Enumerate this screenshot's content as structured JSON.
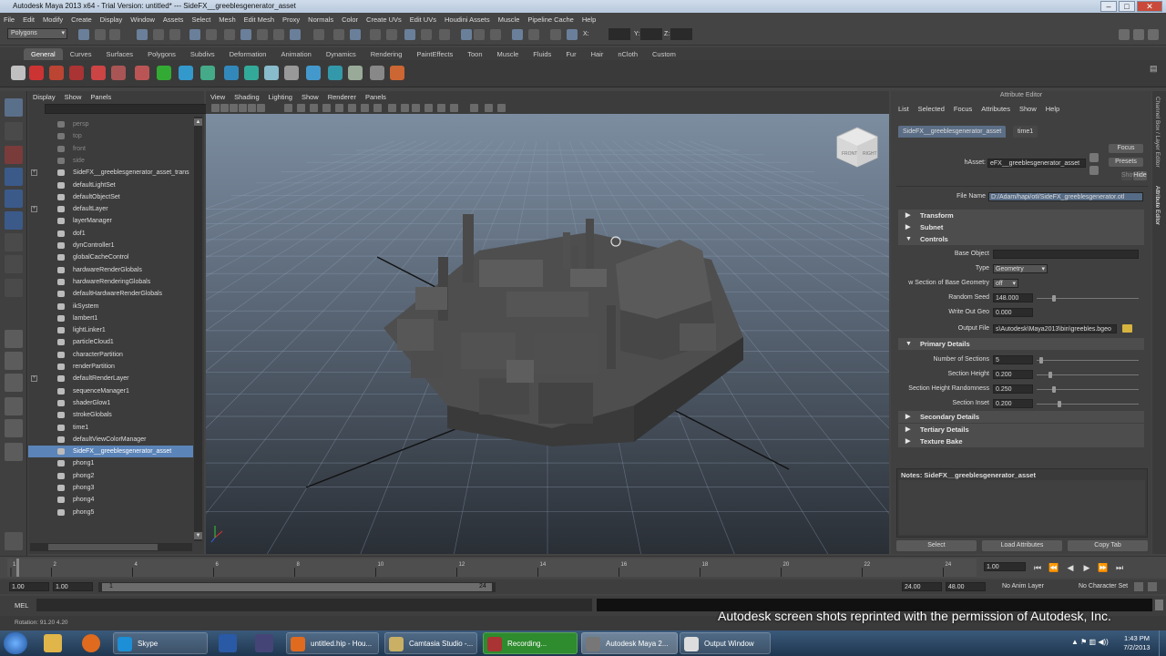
{
  "window": {
    "title": "Autodesk Maya 2013 x64 - Trial Version: untitled*   ---   SideFX__greeblesgenerator_asset"
  },
  "menubar": [
    "File",
    "Edit",
    "Modify",
    "Create",
    "Display",
    "Window",
    "Assets",
    "Select",
    "Mesh",
    "Edit Mesh",
    "Proxy",
    "Normals",
    "Color",
    "Create UVs",
    "Edit UVs",
    "Houdini Assets",
    "Muscle",
    "Pipeline Cache",
    "Help"
  ],
  "statusline": {
    "mode": "Polygons",
    "x_label": "X:",
    "y_label": "Y:",
    "z_label": "Z:"
  },
  "shelf_tabs": [
    "General",
    "Curves",
    "Surfaces",
    "Polygons",
    "Subdivs",
    "Deformation",
    "Animation",
    "Dynamics",
    "Rendering",
    "PaintEffects",
    "Toon",
    "Muscle",
    "Fluids",
    "Fur",
    "Hair",
    "nCloth",
    "Custom"
  ],
  "shelf_active": "General",
  "outliner": {
    "menu": [
      "Display",
      "Show",
      "Panels"
    ],
    "items": [
      {
        "label": "persp",
        "dim": true
      },
      {
        "label": "top",
        "dim": true
      },
      {
        "label": "front",
        "dim": true
      },
      {
        "label": "side",
        "dim": true
      },
      {
        "label": "SideFX__greeblesgenerator_asset_trans",
        "expand": true
      },
      {
        "label": "defaultLightSet"
      },
      {
        "label": "defaultObjectSet"
      },
      {
        "label": "defaultLayer",
        "expand": true
      },
      {
        "label": "layerManager"
      },
      {
        "label": "dof1"
      },
      {
        "label": "dynController1"
      },
      {
        "label": "globalCacheControl"
      },
      {
        "label": "hardwareRenderGlobals"
      },
      {
        "label": "hardwareRenderingGlobals"
      },
      {
        "label": "defaultHardwareRenderGlobals"
      },
      {
        "label": "ikSystem"
      },
      {
        "label": "lambert1"
      },
      {
        "label": "lightLinker1"
      },
      {
        "label": "particleCloud1"
      },
      {
        "label": "characterPartition"
      },
      {
        "label": "renderPartition"
      },
      {
        "label": "defaultRenderLayer",
        "expand": true
      },
      {
        "label": "sequenceManager1"
      },
      {
        "label": "shaderGlow1"
      },
      {
        "label": "strokeGlobals"
      },
      {
        "label": "time1"
      },
      {
        "label": "defaultViewColorManager"
      },
      {
        "label": "SideFX__greeblesgenerator_asset",
        "selected": true
      },
      {
        "label": "phong1"
      },
      {
        "label": "phong2"
      },
      {
        "label": "phong3"
      },
      {
        "label": "phong4"
      },
      {
        "label": "phong5"
      }
    ]
  },
  "viewport": {
    "menu": [
      "View",
      "Shading",
      "Lighting",
      "Show",
      "Renderer",
      "Panels"
    ],
    "viewcube_left": "FRONT",
    "viewcube_right": "RIGHT"
  },
  "attribute_editor": {
    "title": "Attribute Editor",
    "menu": [
      "List",
      "Selected",
      "Focus",
      "Attributes",
      "Show",
      "Help"
    ],
    "tabs": [
      "SideFX__greeblesgenerator_asset",
      "time1"
    ],
    "focus_label": "Focus",
    "presets_label": "Presets",
    "show_label": "Show",
    "hide_label": "Hide",
    "hasset_label": "hAsset:",
    "hasset_value": "eFX__greeblesgenerator_asset",
    "file_name_label": "File Name",
    "file_name_value": "D:/Adam/hapi/otl/SideFX_greeblesgenerator.otl",
    "sections_top": [
      "Transform",
      "Subnet",
      "Controls"
    ],
    "controls": {
      "base_object_label": "Base Object",
      "type_label": "Type",
      "type_value": "Geometry",
      "section_label": "w Section of Base Geometry",
      "section_value": "off",
      "random_seed_label": "Random Seed",
      "random_seed_value": "148.000",
      "write_out_label": "Write Out Geo",
      "write_out_value": "0.000",
      "output_file_label": "Output File",
      "output_file_value": "s\\Autodesk\\Maya2013\\bin\\greebles.bgeo"
    },
    "primary_details_label": "Primary Details",
    "primary": [
      {
        "label": "Number of Sections",
        "value": "5"
      },
      {
        "label": "Section Height",
        "value": "0.200"
      },
      {
        "label": "Section Height Randomness",
        "value": "0.250"
      },
      {
        "label": "Section Inset",
        "value": "0.200"
      }
    ],
    "sections_bottom": [
      "Secondary Details",
      "Tertiary Details",
      "Texture Bake"
    ],
    "notes_label": "Notes:  SideFX__greeblesgenerator_asset",
    "buttons": [
      "Select",
      "Load Attributes",
      "Copy Tab"
    ],
    "side_tabs": [
      "Channel Box / Layer Editor",
      "Attribute Editor"
    ]
  },
  "timeline": {
    "ticks": [
      "1",
      "2",
      "4",
      "6",
      "8",
      "10",
      "12",
      "14",
      "16",
      "18",
      "20",
      "22",
      "24"
    ],
    "current_frame": "1.00",
    "range_start": "1.00",
    "range_inner_start": "1.00",
    "range_mid_left": "1",
    "range_mid_right": "24",
    "range_end": "24.00",
    "range_end2": "48.00",
    "anim_layer": "No Anim Layer",
    "character_set": "No Character Set"
  },
  "cmdline": {
    "label": "MEL"
  },
  "helpline": {
    "text": "Rotation:  91.20    4.20"
  },
  "watermark": "Autodesk screen shots reprinted with the permission of Autodesk, Inc.",
  "taskbar": {
    "items": [
      "Skype",
      "untitled.hip - Hou...",
      "Camtasia Studio -...",
      "Recording...",
      "Autodesk Maya 2...",
      "Output Window"
    ],
    "time": "1:43 PM",
    "date": "7/2/2013"
  }
}
